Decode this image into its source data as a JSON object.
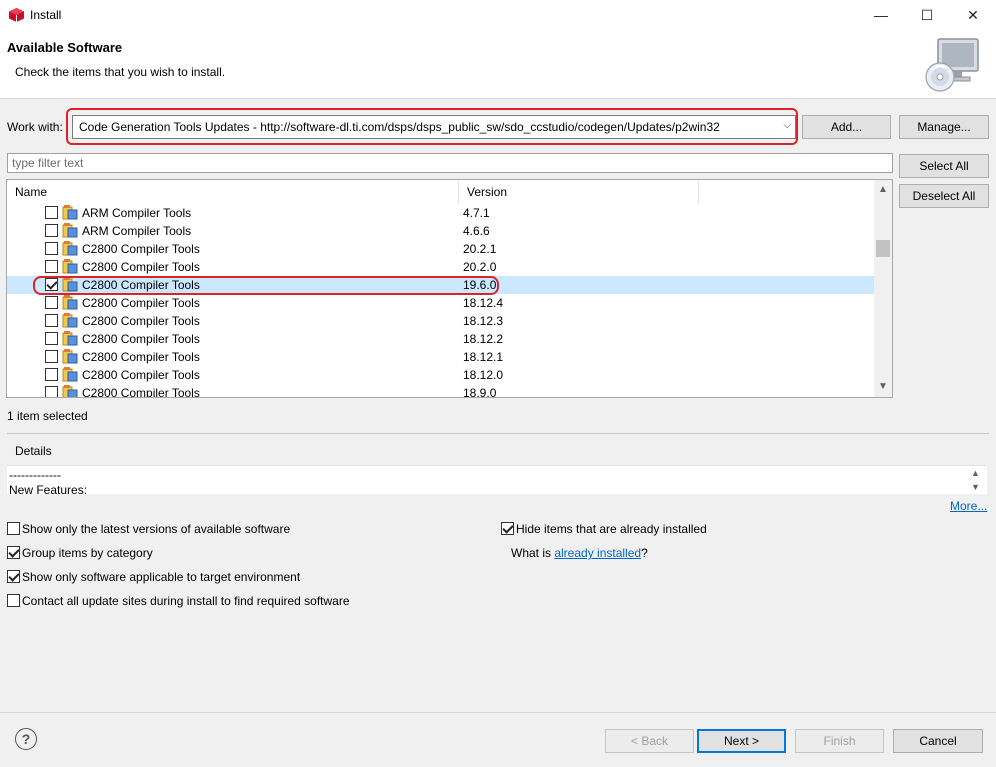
{
  "window": {
    "title": "Install",
    "minimize_glyph": "—",
    "maximize_glyph": "☐",
    "close_glyph": "✕"
  },
  "header": {
    "title": "Available Software",
    "subtitle": "Check the items that you wish to install.",
    "graphic_icon": "install-wizard-cd-computer-icon"
  },
  "work_with": {
    "label": "Work with:",
    "value": "Code Generation Tools Updates - http://software-dl.ti.com/dsps/dsps_public_sw/sdo_ccstudio/codegen/Updates/p2win32",
    "add_label": "Add...",
    "manage_label": "Manage..."
  },
  "filter": {
    "placeholder": "type filter text"
  },
  "side_buttons": {
    "select_all": "Select All",
    "deselect_all": "Deselect All"
  },
  "table": {
    "columns": [
      "Name",
      "Version"
    ],
    "rows": [
      {
        "name": "ARM Compiler Tools",
        "version": "4.7.1",
        "checked": false,
        "selected": false
      },
      {
        "name": "ARM Compiler Tools",
        "version": "4.6.6",
        "checked": false,
        "selected": false
      },
      {
        "name": "C2800 Compiler Tools",
        "version": "20.2.1",
        "checked": false,
        "selected": false
      },
      {
        "name": "C2800 Compiler Tools",
        "version": "20.2.0",
        "checked": false,
        "selected": false
      },
      {
        "name": "C2800 Compiler Tools",
        "version": "19.6.0",
        "checked": true,
        "selected": true
      },
      {
        "name": "C2800 Compiler Tools",
        "version": "18.12.4",
        "checked": false,
        "selected": false
      },
      {
        "name": "C2800 Compiler Tools",
        "version": "18.12.3",
        "checked": false,
        "selected": false
      },
      {
        "name": "C2800 Compiler Tools",
        "version": "18.12.2",
        "checked": false,
        "selected": false
      },
      {
        "name": "C2800 Compiler Tools",
        "version": "18.12.1",
        "checked": false,
        "selected": false
      },
      {
        "name": "C2800 Compiler Tools",
        "version": "18.12.0",
        "checked": false,
        "selected": false
      },
      {
        "name": "C2800 Compiler Tools",
        "version": "18.9.0",
        "checked": false,
        "selected": false
      }
    ]
  },
  "status": "1 item selected",
  "details": {
    "title": "Details",
    "lines": [
      "-------------",
      "New Features:"
    ],
    "more_link": "More..."
  },
  "options": {
    "latest_versions": {
      "label": "Show only the latest versions of available software",
      "checked": false
    },
    "group_by_category": {
      "label": "Group items by category",
      "checked": true
    },
    "applicable_only": {
      "label": "Show only software applicable to target environment",
      "checked": true
    },
    "contact_sites": {
      "label": "Contact all update sites during install to find required software",
      "checked": false
    },
    "hide_installed": {
      "label": "Hide items that are already installed",
      "checked": true
    },
    "what_is_prefix": "What is ",
    "already_installed_link": "already installed",
    "what_is_suffix": "?"
  },
  "footer": {
    "help_glyph": "?",
    "back": "< Back",
    "next": "Next >",
    "finish": "Finish",
    "cancel": "Cancel"
  },
  "colors": {
    "highlight_outline": "#d9252a",
    "selected_row": "#cce8ff",
    "link": "#0066cc",
    "primary_border": "#0078d7"
  }
}
